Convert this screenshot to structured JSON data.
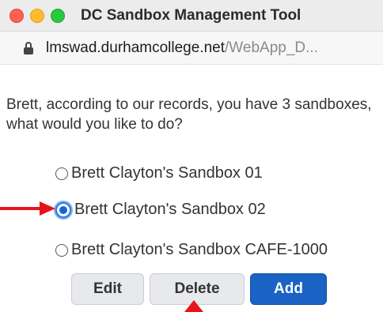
{
  "window": {
    "title": "DC Sandbox Management Tool"
  },
  "address_bar": {
    "domain": "lmswad.durhamcollege.net",
    "path": "/WebApp_D..."
  },
  "prompt_text": "Brett, according to our records, you have 3 sandboxes, what would you like to do?",
  "sandboxes": [
    {
      "label": "Brett Clayton's Sandbox 01",
      "selected": false
    },
    {
      "label": "Brett Clayton's Sandbox 02",
      "selected": true
    },
    {
      "label": "Brett Clayton's Sandbox CAFE-1000",
      "selected": false
    }
  ],
  "buttons": {
    "edit": "Edit",
    "delete": "Delete",
    "add": "Add"
  },
  "annotation_color": "#e8141c"
}
